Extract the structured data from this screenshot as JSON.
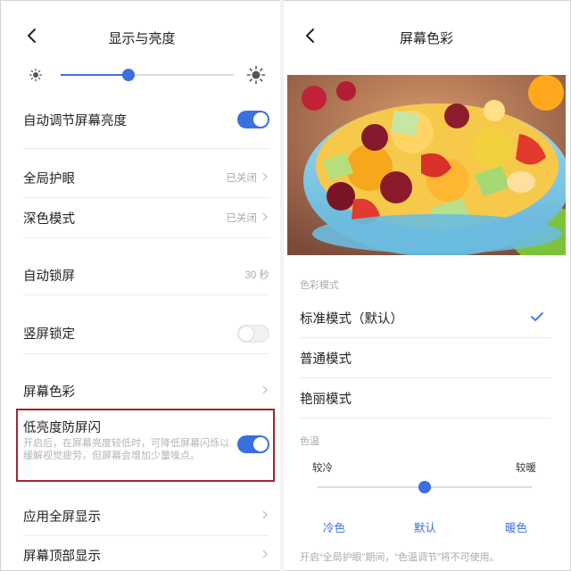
{
  "left": {
    "nav_title": "显示与亮度",
    "brightness": {
      "level": 0.39
    },
    "auto_brightness": {
      "label": "自动调节屏幕亮度",
      "on": true
    },
    "eye_care": {
      "label": "全局护眼",
      "value": "已关闭"
    },
    "dark_mode": {
      "label": "深色模式",
      "value": "已关闭"
    },
    "auto_lock": {
      "label": "自动锁屏",
      "value": "30 秒"
    },
    "portrait_lock": {
      "label": "竖屏锁定",
      "on": false
    },
    "screen_color": {
      "label": "屏幕色彩"
    },
    "anti_flicker": {
      "label": "低亮度防屏闪",
      "description": "开启后，在屏幕亮度较低时，可降低屏幕闪烁以缓解视觉疲劳，但屏幕会增加少量噪点。",
      "on": true
    },
    "full_screen_apps": {
      "label": "应用全屏显示"
    },
    "top_display": {
      "label": "屏幕顶部显示"
    }
  },
  "right": {
    "nav_title": "屏幕色彩",
    "color_mode_section": "色彩模式",
    "modes": [
      {
        "label": "标准模式（默认）",
        "selected": true
      },
      {
        "label": "普通模式",
        "selected": false
      },
      {
        "label": "艳丽模式",
        "selected": false
      }
    ],
    "temp_section": "色温",
    "temp_cool_label": "较冷",
    "temp_warm_label": "较暖",
    "temp_level": 0.5,
    "temp_buttons": {
      "cool": "冷色",
      "default": "默认",
      "warm": "暖色"
    },
    "footnote": "开启“全局护眼”期间，“色温调节”将不可使用。"
  },
  "colors": {
    "accent": "#3a6fe0",
    "highlight_border": "#a3262a"
  },
  "icons": [
    "back-arrow-icon",
    "sun-small-icon",
    "sun-large-icon",
    "chevron-right-icon",
    "checkmark-icon"
  ]
}
